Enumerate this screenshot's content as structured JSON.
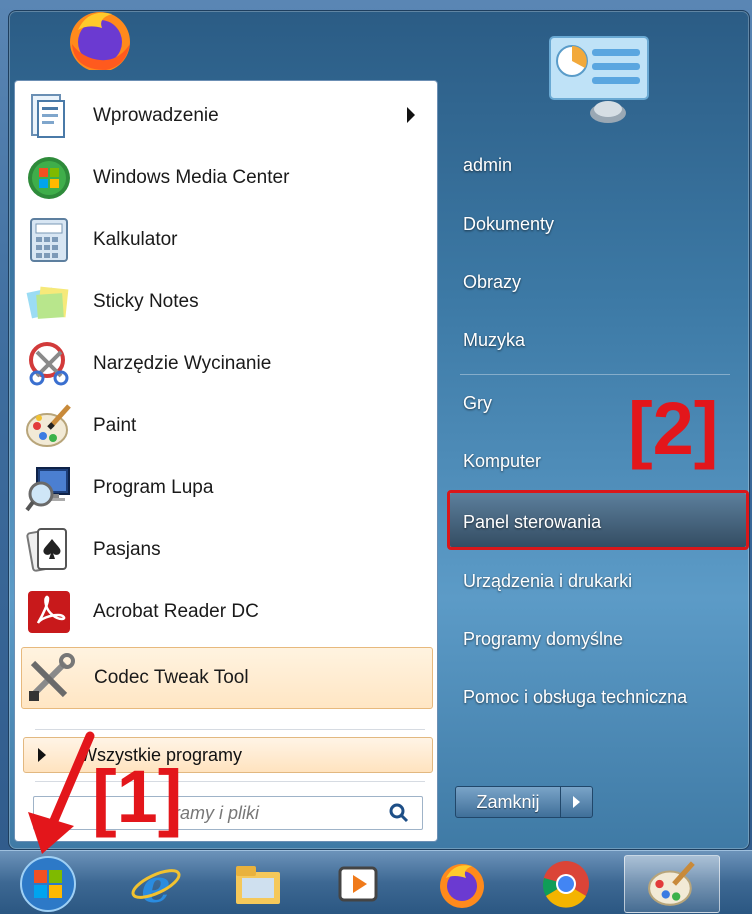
{
  "left_programs": [
    {
      "label": "Wprowadzenie",
      "icon": "getting-started-icon",
      "has_submenu": true
    },
    {
      "label": "Windows Media Center",
      "icon": "windows-media-center-icon"
    },
    {
      "label": "Kalkulator",
      "icon": "calculator-icon"
    },
    {
      "label": "Sticky Notes",
      "icon": "sticky-notes-icon"
    },
    {
      "label": "Narzędzie Wycinanie",
      "icon": "snipping-tool-icon"
    },
    {
      "label": "Paint",
      "icon": "paint-icon"
    },
    {
      "label": "Program Lupa",
      "icon": "magnifier-icon"
    },
    {
      "label": "Pasjans",
      "icon": "solitaire-icon"
    },
    {
      "label": "Acrobat Reader DC",
      "icon": "acrobat-icon"
    },
    {
      "label": "Codec Tweak Tool",
      "icon": "codec-tweak-tool-icon",
      "highlighted": true
    }
  ],
  "all_programs": "Wszystkie programy",
  "search": {
    "placeholder": "Wyszukaj programy i pliki",
    "visible_text": "ramy i pliki"
  },
  "right_links": [
    "admin",
    "Dokumenty",
    "Obrazy",
    "Muzyka",
    "Gry",
    "Komputer",
    "Panel sterowania",
    "Urządzenia i drukarki",
    "Programy domyślne",
    "Pomoc i obsługa techniczna"
  ],
  "shutdown": {
    "label": "Zamknij"
  },
  "annotations": {
    "step1": "[1]",
    "step2": "[2]",
    "color": "#e3161b"
  },
  "taskbar": [
    "start-orb-icon",
    "internet-explorer-icon",
    "file-explorer-icon",
    "media-player-icon",
    "firefox-icon",
    "chrome-icon",
    "paint-icon"
  ]
}
